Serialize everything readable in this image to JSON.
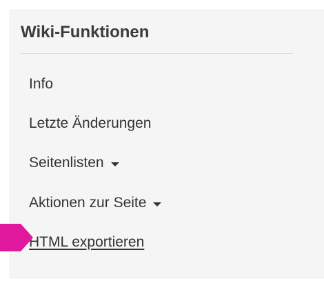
{
  "panel": {
    "title": "Wiki-Funktionen",
    "items": [
      {
        "label": "Info",
        "has_caret": false,
        "underlined": false
      },
      {
        "label": "Letzte Änderungen",
        "has_caret": false,
        "underlined": false
      },
      {
        "label": "Seitenlisten",
        "has_caret": true,
        "underlined": false
      },
      {
        "label": "Aktionen zur Seite",
        "has_caret": true,
        "underlined": false
      },
      {
        "label": "HTML exportieren",
        "has_caret": false,
        "underlined": true
      }
    ]
  },
  "icons": {
    "caret": "caret-down-icon",
    "pointer": "pointer-arrow-icon"
  },
  "colors": {
    "panel_background": "#f5f5f5",
    "text": "#333333",
    "title": "#3b3b3b",
    "pointer_arrow": "#e0189e"
  }
}
